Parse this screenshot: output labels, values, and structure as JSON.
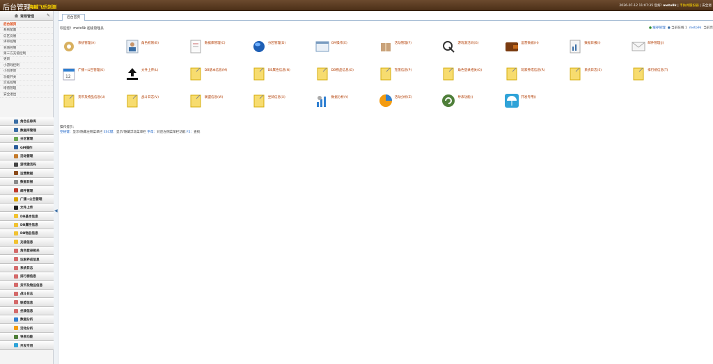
{
  "header": {
    "title": "后台管理",
    "subtitle": "海贼飞乐剑测",
    "datetime": "2026-07-12 11:07:35",
    "greeting": "您好!",
    "username": "meto9k",
    "online": "丰扶闻服扮器",
    "sep": "|",
    "logout": "安全退"
  },
  "sidebar": {
    "header_label": "常规管理",
    "links": [
      "后台首页",
      "系统配置",
      "信区竞展",
      "评审控制",
      "充值控制",
      "第三方充值控制",
      "更新",
      "小游戏控制",
      "小包更新",
      "功能开关",
      "实名控制",
      "增值管理",
      "安全退出"
    ],
    "menu": [
      {
        "label": "角色名称库",
        "icon": "db"
      },
      {
        "label": "数据库管理",
        "icon": "db"
      },
      {
        "label": "分区管理",
        "icon": "doc"
      },
      {
        "label": "GM操作",
        "icon": "gm"
      },
      {
        "label": "活动管理",
        "icon": "gift"
      },
      {
        "label": "游戏激活码",
        "icon": "search"
      },
      {
        "label": "运营数据",
        "icon": "wallet"
      },
      {
        "label": "数据日报",
        "icon": "page"
      },
      {
        "label": "邮件管理",
        "icon": "mail"
      },
      {
        "label": "广播+公告管理",
        "icon": "speaker"
      },
      {
        "label": "文件上传",
        "icon": "upload"
      },
      {
        "label": "DB基本信息",
        "icon": "folder"
      },
      {
        "label": "DB属性信息",
        "icon": "folder"
      },
      {
        "label": "DB物品信息",
        "icon": "folder"
      },
      {
        "label": "充值信息",
        "icon": "folder"
      },
      {
        "label": "角色登录相关",
        "icon": "pen"
      },
      {
        "label": "玩家养成信息",
        "icon": "pen"
      },
      {
        "label": "系统日志",
        "icon": "pen"
      },
      {
        "label": "排行榜信息",
        "icon": "pen"
      },
      {
        "label": "货币及物品信息",
        "icon": "pen"
      },
      {
        "label": "战斗日志",
        "icon": "pen"
      },
      {
        "label": "联盟信息",
        "icon": "pen"
      },
      {
        "label": "坐骑信息",
        "icon": "pen"
      },
      {
        "label": "数据分析",
        "icon": "chart"
      },
      {
        "label": "活动分析",
        "icon": "pie"
      },
      {
        "label": "导表功能",
        "icon": "refresh"
      },
      {
        "label": "开发专用",
        "icon": "umbrella"
      }
    ]
  },
  "main": {
    "tab": "后台首页",
    "welcome": "欢迎您！meto9k 超级管理员",
    "cache_link": "缓存管理",
    "current_label": "当前在线 1",
    "current_user": "meto9k",
    "current_page": "当前页",
    "tiles": [
      {
        "label": "系统管理(A)",
        "icon": "gear"
      },
      {
        "label": "角色权限(B)",
        "icon": "person"
      },
      {
        "label": "数据库管理(C)",
        "icon": "page"
      },
      {
        "label": "分区管理(D)",
        "icon": "globe"
      },
      {
        "label": "GM操作(E)",
        "icon": "window"
      },
      {
        "label": "活动管理(F)",
        "icon": "gift"
      },
      {
        "label": "游戏激活码(G)",
        "icon": "cursor"
      },
      {
        "label": "运营数据(H)",
        "icon": "wallet"
      },
      {
        "label": "数据日报(I)",
        "icon": "chartpage"
      },
      {
        "label": "邮件管理(J)",
        "icon": "mail"
      },
      {
        "label": "广播+公告管理(K)",
        "icon": "calendar"
      },
      {
        "label": "文件上传(L)",
        "icon": "upload"
      },
      {
        "label": "DB基本信息(M)",
        "icon": "note"
      },
      {
        "label": "DB属性信息(N)",
        "icon": "note"
      },
      {
        "label": "DB物品信息(O)",
        "icon": "note"
      },
      {
        "label": "充值信息(P)",
        "icon": "note"
      },
      {
        "label": "角色登录相关(Q)",
        "icon": "note"
      },
      {
        "label": "玩家养成信息(R)",
        "icon": "note"
      },
      {
        "label": "系统日志(S)",
        "icon": "note"
      },
      {
        "label": "排行榜信息(T)",
        "icon": "note"
      },
      {
        "label": "货币及物品信息(U)",
        "icon": "note"
      },
      {
        "label": "战斗日志(V)",
        "icon": "note"
      },
      {
        "label": "联盟信息(W)",
        "icon": "note"
      },
      {
        "label": "坐骑信息(X)",
        "icon": "note"
      },
      {
        "label": "数据分析(Y)",
        "icon": "bars"
      },
      {
        "label": "活动分析(Z)",
        "icon": "pie"
      },
      {
        "label": "导表功能()",
        "icon": "refresh"
      },
      {
        "label": "开发专用()",
        "icon": "umbrella"
      }
    ],
    "note_title": "操作提示：",
    "note_k1": "空格键：",
    "note_t1": "显示/隐藏左侧菜单栏",
    "note_k2": "ESC键：",
    "note_t2": "显示/隐藏浮动菜单栏",
    "note_k3": "字母：",
    "note_t3": "对应左侧菜单栏功能",
    "note_k4": "F2：",
    "note_t4": "查找"
  },
  "colors": {
    "header_bg": "#5a3b22",
    "subtitle": "#ffd800",
    "tile_label": "#b23c00",
    "active_link": "#e03c00",
    "link_blue": "#1d64c8"
  }
}
